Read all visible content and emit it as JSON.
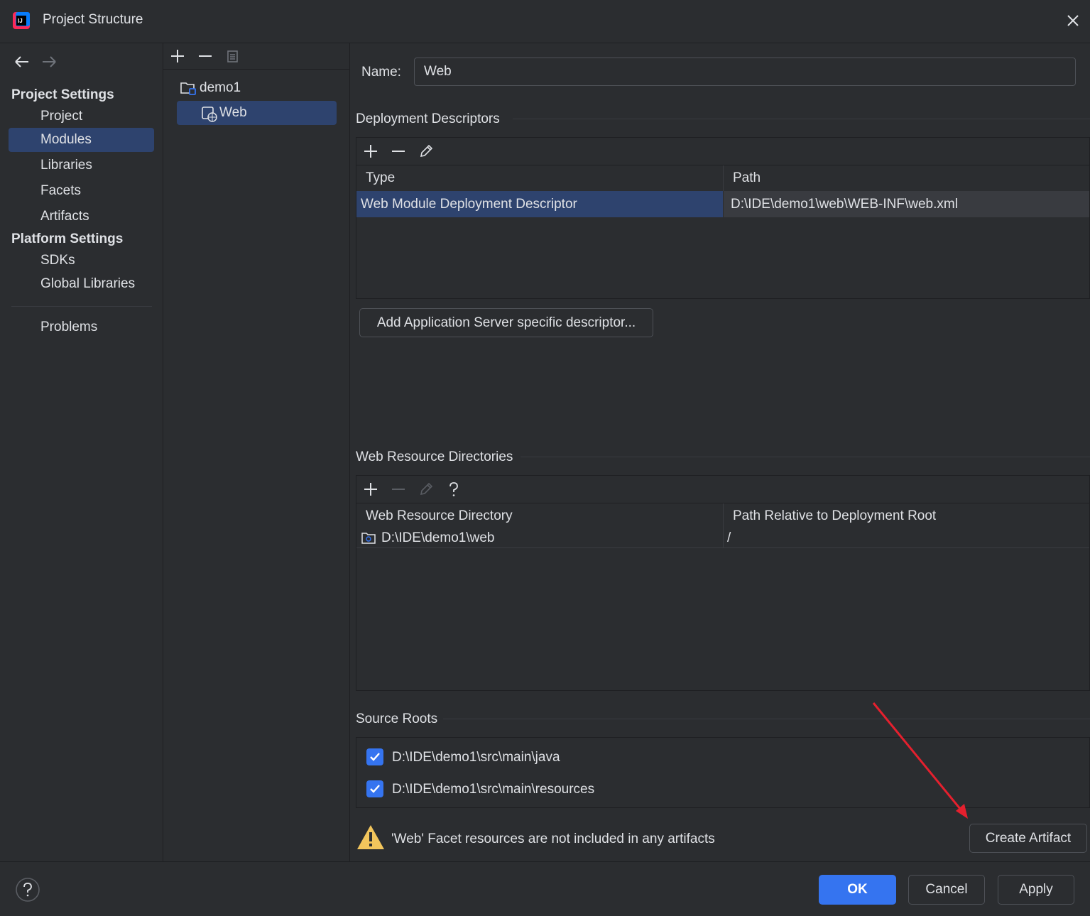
{
  "window": {
    "title": "Project Structure"
  },
  "nav": {
    "project_settings_header": "Project Settings",
    "platform_settings_header": "Platform Settings",
    "items": [
      "Project",
      "Modules",
      "Libraries",
      "Facets",
      "Artifacts"
    ],
    "platform_items": [
      "SDKs",
      "Global Libraries"
    ],
    "problems": "Problems",
    "selected": "Modules"
  },
  "tree": {
    "nodes": [
      {
        "label": "demo1",
        "icon": "module-folder-icon"
      },
      {
        "label": "Web",
        "icon": "web-facet-icon",
        "selected": true
      }
    ]
  },
  "form": {
    "name_label": "Name:",
    "name_value": "Web"
  },
  "deployment_descriptors": {
    "title": "Deployment Descriptors",
    "columns": [
      "Type",
      "Path"
    ],
    "rows": [
      {
        "type": "Web Module Deployment Descriptor",
        "path": "D:\\IDE\\demo1\\web\\WEB-INF\\web.xml"
      }
    ],
    "add_button": "Add Application Server specific descriptor..."
  },
  "web_resource_directories": {
    "title": "Web Resource Directories",
    "columns": [
      "Web Resource Directory",
      "Path Relative to Deployment Root"
    ],
    "rows": [
      {
        "directory": "D:\\IDE\\demo1\\web",
        "relative_path": "/"
      }
    ]
  },
  "source_roots": {
    "title": "Source Roots",
    "items": [
      {
        "path": "D:\\IDE\\demo1\\src\\main\\java",
        "checked": true
      },
      {
        "path": "D:\\IDE\\demo1\\src\\main\\resources",
        "checked": true
      }
    ]
  },
  "warning": {
    "text": "'Web' Facet resources are not included in any artifacts",
    "action": "Create Artifact"
  },
  "footer": {
    "ok": "OK",
    "cancel": "Cancel",
    "apply": "Apply"
  },
  "colors": {
    "accent": "#3574f0",
    "selection": "#2e436e",
    "warning": "#f2c55c",
    "annotation_arrow": "#e5202e"
  }
}
